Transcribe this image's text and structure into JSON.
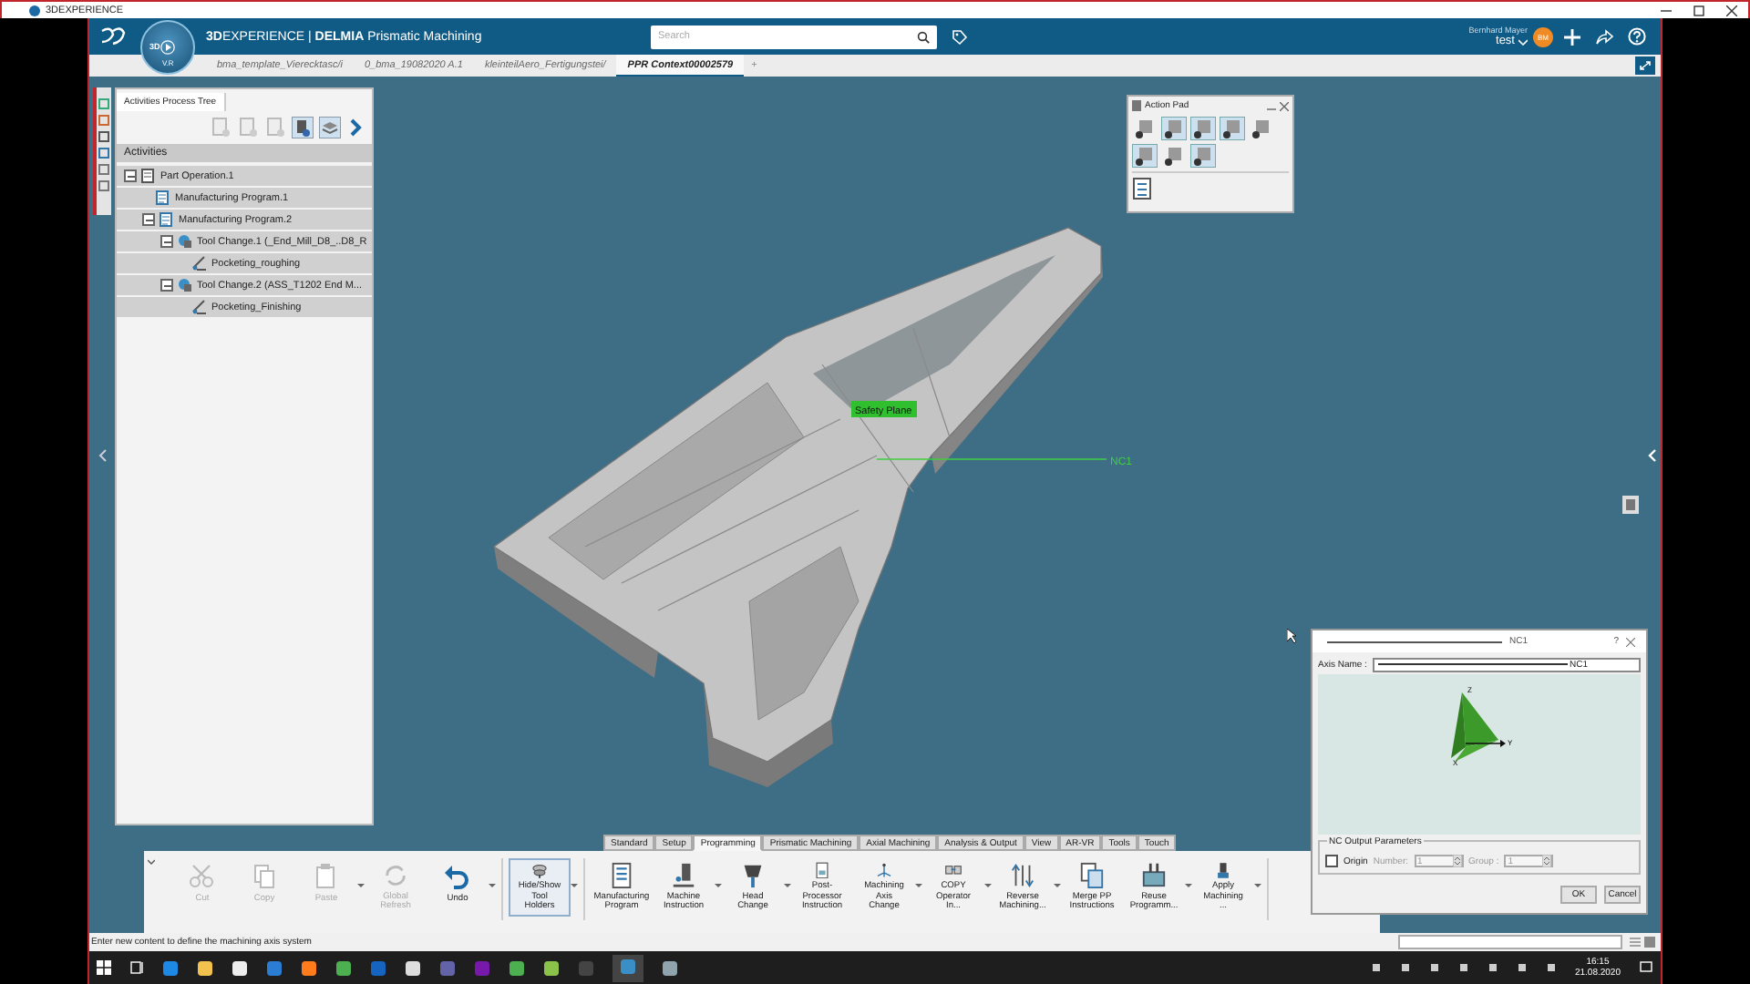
{
  "window": {
    "title": "3DEXPERIENCE"
  },
  "header": {
    "compass": [
      "3D",
      "V.R"
    ],
    "brand": "**3D**EXPERIENCE | **DELMIA** Prismatic Machining",
    "search": {
      "placeholder": "Search"
    },
    "user_name": "Bernhard Mayer",
    "workspace": "test",
    "avatar": "BM"
  },
  "doc_tabs": [
    {
      "label": "bma_template_Vierecktasc/i",
      "selected": false
    },
    {
      "label": "0_bma_19082020 A.1",
      "selected": false
    },
    {
      "label": "kleinteilAero_Fertigungstei/",
      "selected": false
    },
    {
      "label": "PPR Context00002579",
      "selected": true
    }
  ],
  "new_tab": "+",
  "tree_panel": {
    "tab": "Activities Process Tree",
    "header": "Activities",
    "nodes": [
      {
        "label": "Part Operation.1",
        "kind": "operation",
        "expanded": true,
        "children": [
          {
            "label": "Manufacturing Program.1",
            "kind": "program"
          },
          {
            "label": "Manufacturing Program.2",
            "kind": "program",
            "expanded": true,
            "children": [
              {
                "label": "Tool Change.1 (_End_Mill_D8_..D8_R",
                "kind": "tool_change",
                "expanded": true,
                "children": [
                  {
                    "label": "Pocketing_roughing",
                    "kind": "activity"
                  }
                ]
              },
              {
                "label": "Tool Change.2 (ASS_T1202 End M...",
                "kind": "tool_change",
                "expanded": true,
                "children": [
                  {
                    "label": "Pocketing_Finishing",
                    "kind": "activity"
                  }
                ]
              }
            ]
          }
        ]
      }
    ]
  },
  "action_pad": {
    "title": "Action Pad"
  },
  "viewport": {
    "plane_label": "Safety Plane",
    "axis_label": "NC1"
  },
  "ribbon": {
    "tabs": [
      {
        "label": "Standard",
        "selected": false
      },
      {
        "label": "Setup",
        "selected": false
      },
      {
        "label": "Programming",
        "selected": true
      },
      {
        "label": "Prismatic Machining",
        "selected": false
      },
      {
        "label": "Axial Machining",
        "selected": false
      },
      {
        "label": "Analysis & Output",
        "selected": false
      },
      {
        "label": "View",
        "selected": false
      },
      {
        "label": "AR-VR",
        "selected": false
      },
      {
        "label": "Tools",
        "selected": false
      },
      {
        "label": "Touch",
        "selected": false
      }
    ],
    "tool_groups": [
      [
        {
          "label": "Cut",
          "disabled": true,
          "selected": false,
          "dropdown": false
        },
        {
          "label": "Copy",
          "disabled": true,
          "selected": false,
          "dropdown": false
        },
        {
          "label": "Paste",
          "disabled": true,
          "selected": false,
          "dropdown": true
        },
        {
          "label": "Global Refresh",
          "disabled": true,
          "selected": false,
          "dropdown": false
        },
        {
          "label": "Undo",
          "disabled": false,
          "selected": false,
          "dropdown": true
        }
      ],
      [
        {
          "label": "Hide/Show Tool Holders",
          "disabled": false,
          "selected": true,
          "dropdown": true
        }
      ],
      [
        {
          "label": "Manufacturing Program",
          "disabled": false,
          "selected": false,
          "dropdown": false
        },
        {
          "label": "Machine Instruction",
          "disabled": false,
          "selected": false,
          "dropdown": true
        },
        {
          "label": "Head Change",
          "disabled": false,
          "selected": false,
          "dropdown": true
        },
        {
          "label": "Post-Processor Instruction",
          "disabled": false,
          "selected": false,
          "dropdown": false
        },
        {
          "label": "Machining Axis Change",
          "disabled": false,
          "selected": false,
          "dropdown": true
        },
        {
          "label": "COPY Operator In...",
          "disabled": false,
          "selected": false,
          "dropdown": true
        },
        {
          "label": "Reverse Machining...",
          "disabled": false,
          "selected": false,
          "dropdown": true
        },
        {
          "label": "Merge PP Instructions",
          "disabled": false,
          "selected": false,
          "dropdown": false
        },
        {
          "label": "Reuse Programm...",
          "disabled": false,
          "selected": false,
          "dropdown": true
        },
        {
          "label": "Apply Machining ...",
          "disabled": false,
          "selected": false,
          "dropdown": true
        }
      ]
    ]
  },
  "dialog": {
    "title": "NC1",
    "help": "?",
    "axis_name_label": "Axis Name :",
    "axis_name_value": "NC1",
    "axis_letters": [
      "Z",
      "Y",
      "X"
    ],
    "group_title": "NC Output Parameters",
    "origin": {
      "label": "Origin",
      "checked": false
    },
    "number": {
      "label": "Number:",
      "value": "1",
      "disabled": true
    },
    "group": {
      "label": "Group :",
      "value": "1",
      "disabled": true
    },
    "buttons": [
      "OK",
      "Cancel"
    ]
  },
  "status_bar": {
    "message": "Enter new content to define the machining axis system"
  },
  "taskbar": {
    "time": "16:15",
    "date": "21.08.2020"
  }
}
